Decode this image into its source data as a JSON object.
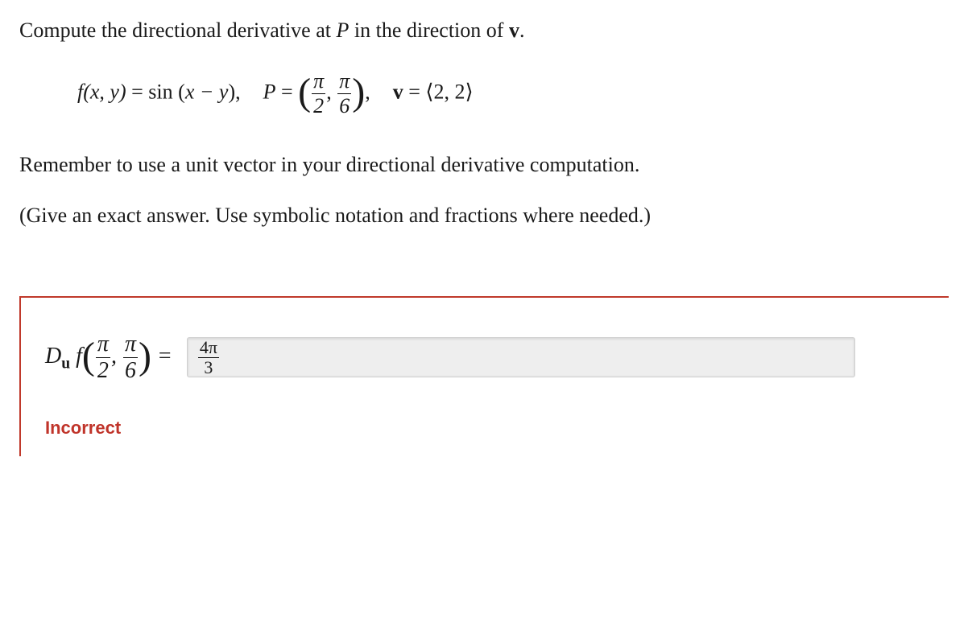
{
  "question": {
    "line1_a": "Compute the directional derivative at ",
    "line1_P": "P",
    "line1_b": " in the direction of ",
    "line1_v": "v",
    "line1_c": "."
  },
  "formula": {
    "f_lhs": "f(x, y)",
    "eq": " = ",
    "sin": "sin",
    "sin_arg_open": " (",
    "sin_arg": "x − y",
    "sin_arg_close": "),",
    "P": "P",
    "paren_open": "(",
    "pi": "π",
    "two": "2",
    "six": "6",
    "comma": ", ",
    "paren_close": ")",
    "post_P": ",",
    "v": "v",
    "v_rhs_open": "⟨",
    "v_rhs": "2, 2",
    "v_rhs_close": "⟩"
  },
  "instructions": {
    "line1": "Remember to use a unit vector in your directional derivative computation.",
    "line2": "(Give an exact answer. Use symbolic notation and fractions where needed.)"
  },
  "answer": {
    "D": "D",
    "u": "u",
    "f": " f",
    "eq": " = ",
    "input_num": "4π",
    "input_den": "3"
  },
  "feedback": "Incorrect"
}
